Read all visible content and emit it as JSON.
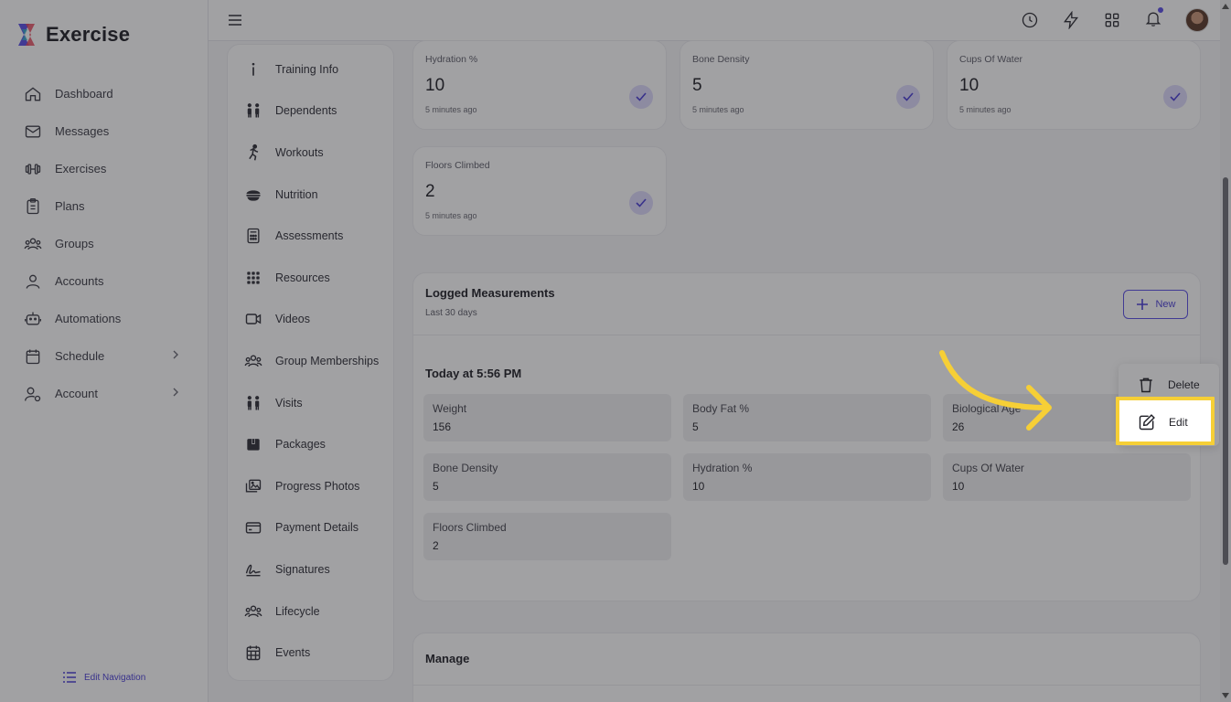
{
  "brand": {
    "name": "Exercise"
  },
  "nav": {
    "items": [
      {
        "label": "Dashboard",
        "icon": "home-icon"
      },
      {
        "label": "Messages",
        "icon": "mail-icon"
      },
      {
        "label": "Exercises",
        "icon": "dumbbell-icon"
      },
      {
        "label": "Plans",
        "icon": "clipboard-icon"
      },
      {
        "label": "Groups",
        "icon": "users-icon"
      },
      {
        "label": "Accounts",
        "icon": "user-icon"
      },
      {
        "label": "Automations",
        "icon": "robot-icon"
      },
      {
        "label": "Schedule",
        "icon": "calendar-icon",
        "has_chevron": true
      },
      {
        "label": "Account",
        "icon": "user-gear-icon",
        "has_chevron": true
      }
    ],
    "edit_navigation": "Edit Navigation"
  },
  "subnav": {
    "items": [
      {
        "label": "Training Info"
      },
      {
        "label": "Dependents"
      },
      {
        "label": "Workouts"
      },
      {
        "label": "Nutrition"
      },
      {
        "label": "Assessments"
      },
      {
        "label": "Resources"
      },
      {
        "label": "Videos"
      },
      {
        "label": "Group Memberships"
      },
      {
        "label": "Visits"
      },
      {
        "label": "Packages"
      },
      {
        "label": "Progress Photos"
      },
      {
        "label": "Payment Details"
      },
      {
        "label": "Signatures"
      },
      {
        "label": "Lifecycle"
      },
      {
        "label": "Events"
      }
    ]
  },
  "stats": [
    {
      "label": "Hydration %",
      "value": "10",
      "time": "5 minutes ago"
    },
    {
      "label": "Bone Density",
      "value": "5",
      "time": "5 minutes ago"
    },
    {
      "label": "Cups Of Water",
      "value": "10",
      "time": "5 minutes ago"
    },
    {
      "label": "Floors Climbed",
      "value": "2",
      "time": "5 minutes ago"
    }
  ],
  "logged": {
    "title": "Logged Measurements",
    "subtitle": "Last 30 days",
    "new_label": "New",
    "entry_title": "Today at 5:56 PM",
    "measurements": [
      {
        "label": "Weight",
        "value": "156"
      },
      {
        "label": "Body Fat %",
        "value": "5"
      },
      {
        "label": "Biological Age",
        "value": "26"
      },
      {
        "label": "Bone Density",
        "value": "5"
      },
      {
        "label": "Hydration %",
        "value": "10"
      },
      {
        "label": "Cups Of Water",
        "value": "10"
      },
      {
        "label": "Floors Climbed",
        "value": "2"
      }
    ]
  },
  "menu": {
    "delete_label": "Delete",
    "edit_label": "Edit"
  },
  "manage": {
    "title": "Manage"
  },
  "colors": {
    "accent": "#5a4ee6",
    "highlight": "#f6cf36",
    "check_bg": "#ddd9fb"
  }
}
